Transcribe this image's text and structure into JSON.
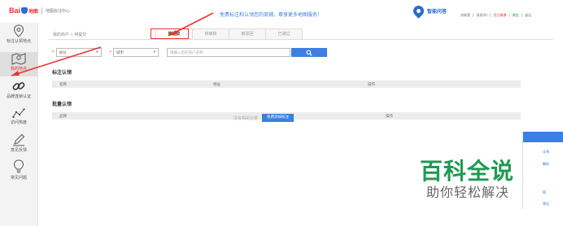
{
  "header": {
    "logo_bai": "Bai",
    "logo_map": "地图",
    "logo_title": "地图标注中心",
    "slogan": "免费标注和认领您的商铺，尊享更多地图服务！",
    "brand": "智能问答",
    "links": [
      "训练营",
      "消息(0)",
      "官方微博",
      "微信",
      "退出"
    ],
    "colors": {
      "accent": "#3d7fe0",
      "red": "#e33333"
    }
  },
  "sidebar": {
    "items": [
      {
        "label": "标注认领地点",
        "icon": "location-pin-icon"
      },
      {
        "label": "我的地点",
        "icon": "map-icon"
      },
      {
        "label": "品牌连锁认证",
        "icon": "chain-link-icon"
      },
      {
        "label": "访问热度",
        "icon": "trend-chart-icon"
      },
      {
        "label": "意见反馈",
        "icon": "pencil-icon"
      },
      {
        "label": "常见问题",
        "icon": "lightbulb-icon"
      }
    ]
  },
  "breadcrumb": {
    "root": "我的商户",
    "sep": "»",
    "current": "待提交"
  },
  "tabs": [
    "待提交",
    "待审核",
    "被驳回",
    "已通过"
  ],
  "filters": {
    "province": "省份",
    "city": "城市",
    "search_placeholder": "请输入您的商户名称"
  },
  "sections": {
    "single": {
      "title": "标注认领",
      "columns": [
        "名称",
        "地址",
        "操作"
      ]
    },
    "batch": {
      "title": "批量认领",
      "columns": [
        "品牌",
        "操作"
      ]
    }
  },
  "empty": {
    "text": "没有相关记录",
    "button": "免费添加标注"
  },
  "float_panel": {
    "items": [
      "认领",
      "解析",
      "帮",
      "常见"
    ]
  },
  "watermark": {
    "main": "百科全说",
    "sub": "助你轻松解决"
  }
}
